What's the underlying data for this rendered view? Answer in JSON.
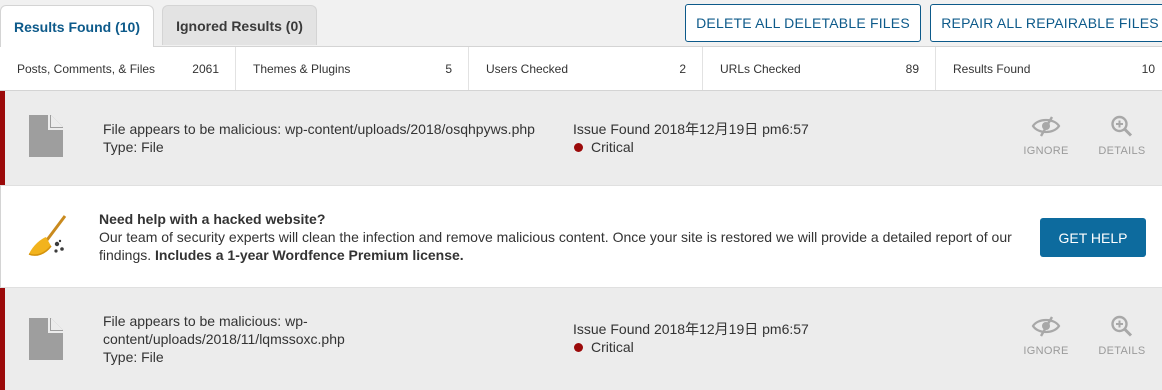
{
  "tabs": [
    {
      "label": "Results Found (10)",
      "active": true
    },
    {
      "label": "Ignored Results (0)",
      "active": false
    }
  ],
  "toolbar": {
    "delete_label": "DELETE ALL DELETABLE FILES",
    "repair_label": "REPAIR ALL REPAIRABLE FILES"
  },
  "stats": [
    {
      "label": "Posts, Comments, & Files",
      "value": "2061"
    },
    {
      "label": "Themes & Plugins",
      "value": "5"
    },
    {
      "label": "Users Checked",
      "value": "2"
    },
    {
      "label": "URLs Checked",
      "value": "89"
    },
    {
      "label": "Results Found",
      "value": "10"
    }
  ],
  "issues": [
    {
      "title": "File appears to be malicious: wp-content/uploads/2018/osqhpyws.php",
      "type": "Type: File",
      "found": "Issue Found 2018年12月19日 pm6:57",
      "severity": "Critical",
      "ignore_label": "IGNORE",
      "details_label": "DETAILS",
      "icon": "file-icon"
    },
    {
      "title": "File appears to be malicious: wp-content/uploads/2018/11/lqmssoxc.php",
      "type": "Type: File",
      "found": "Issue Found 2018年12月19日 pm6:57",
      "severity": "Critical",
      "ignore_label": "IGNORE",
      "details_label": "DETAILS",
      "icon": "file-icon"
    }
  ],
  "help": {
    "title": "Need help with a hacked website?",
    "body": "Our team of security experts will clean the infection and remove malicious content. Once your site is restored we will provide a detailed report of our findings.",
    "emphasis": "Includes a 1-year Wordfence Premium license.",
    "button_label": "GET HELP",
    "icon": "broom-icon"
  },
  "colors": {
    "accent": "#0d5a8a",
    "critical": "#9b0a0a",
    "button_fill": "#0d6b9e"
  }
}
